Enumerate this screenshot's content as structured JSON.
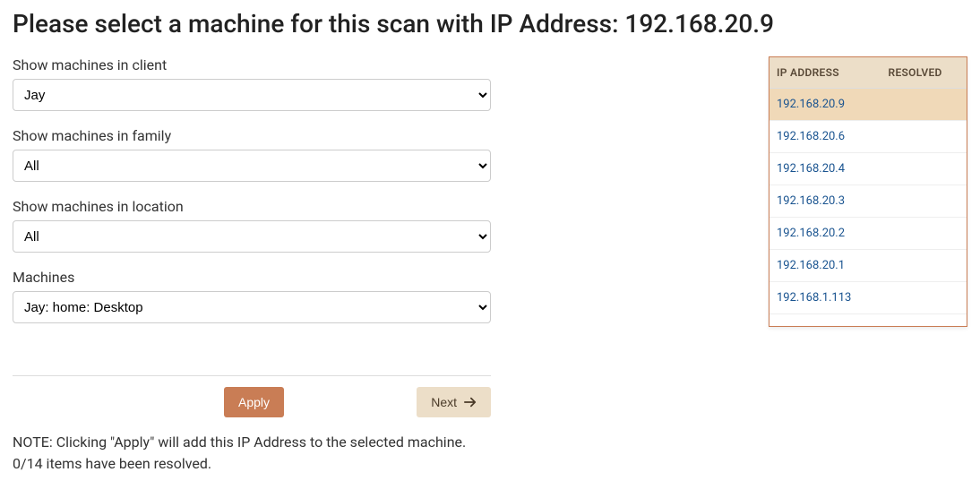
{
  "title": "Please select a machine for this scan with IP Address: 192.168.20.9",
  "form": {
    "client_label": "Show machines in client",
    "client_value": "Jay",
    "family_label": "Show machines in family",
    "family_value": "All",
    "location_label": "Show machines in location",
    "location_value": "All",
    "machines_label": "Machines",
    "machines_value": "Jay: home: Desktop"
  },
  "buttons": {
    "apply": "Apply",
    "next": "Next"
  },
  "note_line1": "NOTE: Clicking \"Apply\" will add this IP Address to the selected machine.",
  "note_line2": "0/14 items have been resolved.",
  "table": {
    "headers": {
      "ip": "IP ADDRESS",
      "resolved": "RESOLVED"
    },
    "rows": [
      {
        "ip": "192.168.20.9",
        "resolved": "",
        "selected": true
      },
      {
        "ip": "192.168.20.6",
        "resolved": "",
        "selected": false
      },
      {
        "ip": "192.168.20.4",
        "resolved": "",
        "selected": false
      },
      {
        "ip": "192.168.20.3",
        "resolved": "",
        "selected": false
      },
      {
        "ip": "192.168.20.2",
        "resolved": "",
        "selected": false
      },
      {
        "ip": "192.168.20.1",
        "resolved": "",
        "selected": false
      },
      {
        "ip": "192.168.1.113",
        "resolved": "",
        "selected": false
      }
    ]
  }
}
